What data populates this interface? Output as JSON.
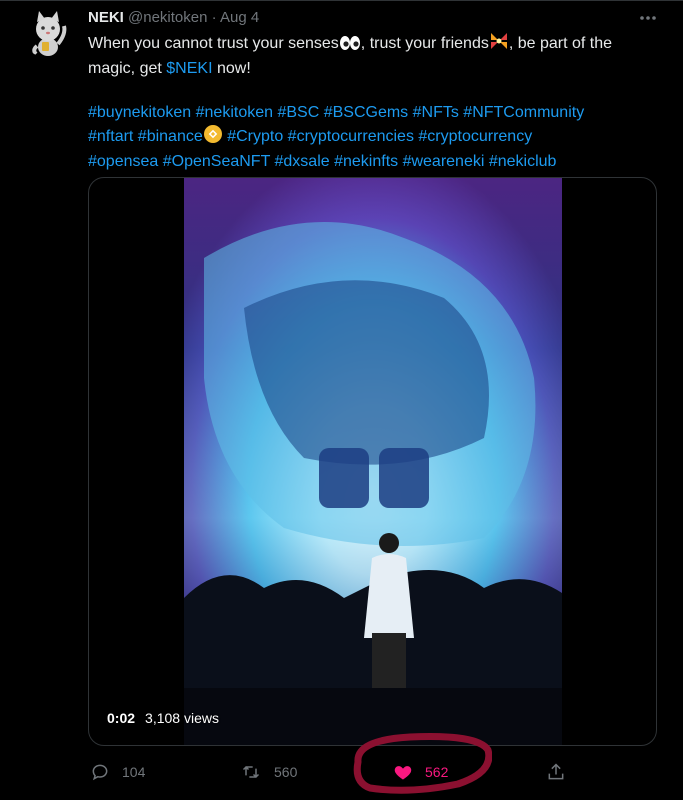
{
  "tweet": {
    "display_name": "NEKI",
    "handle": "@nekitoken",
    "separator": "·",
    "date": "Aug 4",
    "text_part1": "When you cannot trust your senses",
    "text_part2": ", trust your friends",
    "text_part3": ", be part of the magic, get ",
    "cashtag": "$NEKI",
    "text_part4": " now!",
    "hashtags_line1": "#buynekitoken #nekitoken #BSC #BSCGems #NFTs #NFTCommunity",
    "hashtags_line2a": "#nftart #binance",
    "hashtags_line2b": " #Crypto #cryptocurrencies #cryptocurrency",
    "hashtags_line3": "#opensea #OpenSeaNFT #dxsale #nekinfts #weareneki #nekiclub"
  },
  "video": {
    "timestamp": "0:02",
    "views": "3,108 views"
  },
  "actions": {
    "reply_count": "104",
    "retweet_count": "560",
    "like_count": "562"
  },
  "colors": {
    "link": "#1d9bf0",
    "like": "#f91880",
    "annotation_circle": "#8b1030"
  },
  "icons": {
    "more": "more-icon",
    "reply": "reply-icon",
    "retweet": "retweet-icon",
    "like": "heart-icon",
    "share": "share-icon",
    "eyes_emoji": "eyes-emoji-icon",
    "sparkle_emoji": "sparkle-emoji-icon",
    "binance": "binance-icon"
  }
}
